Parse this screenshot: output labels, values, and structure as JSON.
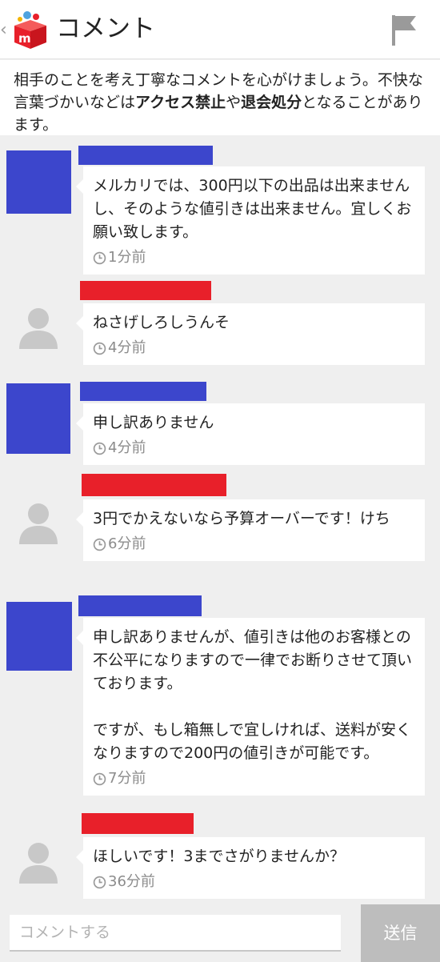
{
  "header": {
    "back_glyph": "‹",
    "title": "コメント",
    "icons": {
      "back": "chevron-left-icon",
      "logo": "mercari-box-logo",
      "report": "flag-icon"
    }
  },
  "notice": {
    "part1": "相手のことを考え丁寧なコメントを心がけましょう。不快な言葉づかいなどは",
    "bold1": "アクセス禁止",
    "part2": "や",
    "bold2": "退会処分",
    "part3": "となることがあります。"
  },
  "comments": [
    {
      "author_color": "#3c46cc",
      "text": "メルカリでは、300円以下の出品は出来ませんし、そのような値引きは出来ません。宜しくお願い致します。",
      "time": "1分前"
    },
    {
      "author_color": "#e8202a",
      "text": "ねさげしろしうんそ",
      "time": "4分前"
    },
    {
      "author_color": "#3c46cc",
      "text": "申し訳ありません",
      "time": "4分前"
    },
    {
      "author_color": "#e8202a",
      "text": "3円でかえないなら予算オーバーです！けち",
      "time": "6分前"
    },
    {
      "author_color": "#3c46cc",
      "text": "申し訳ありませんが、値引きは他のお客様との不公平になりますので一律でお断りさせて頂いております。\n\nですが、もし箱無しで宜しければ、送料が安くなりますので200円の値引きが可能です。",
      "time": "7分前"
    },
    {
      "author_color": "#e8202a",
      "text": "ほしいです！3までさがりませんか？",
      "time": "36分前"
    }
  ],
  "footer": {
    "input_placeholder": "コメントする",
    "input_value": "",
    "send_label": "送信"
  },
  "colors": {
    "background": "#efefef",
    "seller": "#3c46cc",
    "buyer": "#e8202a",
    "send_button": "#bdbdbd",
    "logo_red": "#e8202a"
  }
}
